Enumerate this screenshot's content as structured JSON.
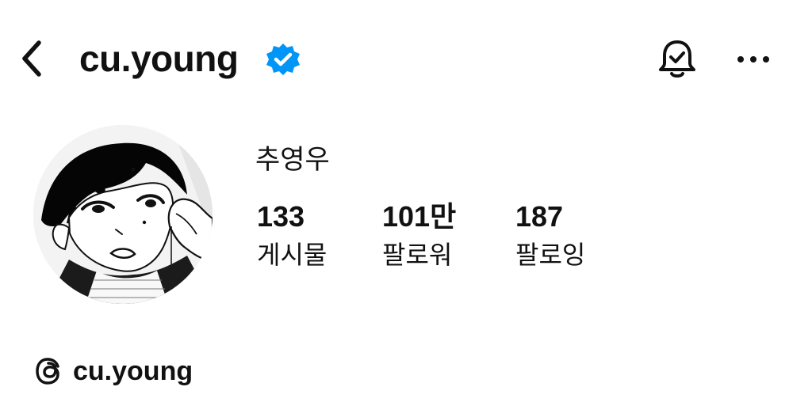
{
  "header": {
    "back_icon": "chevron-left-icon",
    "username": "cu.young",
    "verified_icon": "verified-badge-icon",
    "notification_icon": "bell-check-icon",
    "more_icon": "more-horizontal-icon"
  },
  "profile": {
    "display_name": "추영우",
    "avatar": "manga-style-profile-avatar",
    "stats": [
      {
        "value": "133",
        "label": "게시물"
      },
      {
        "value": "101만",
        "label": "팔로워"
      },
      {
        "value": "187",
        "label": "팔로잉"
      }
    ]
  },
  "threads": {
    "icon": "threads-icon",
    "handle": "cu.young"
  },
  "colors": {
    "text": "#111111",
    "background": "#ffffff",
    "verified_blue": "#0095f6"
  }
}
